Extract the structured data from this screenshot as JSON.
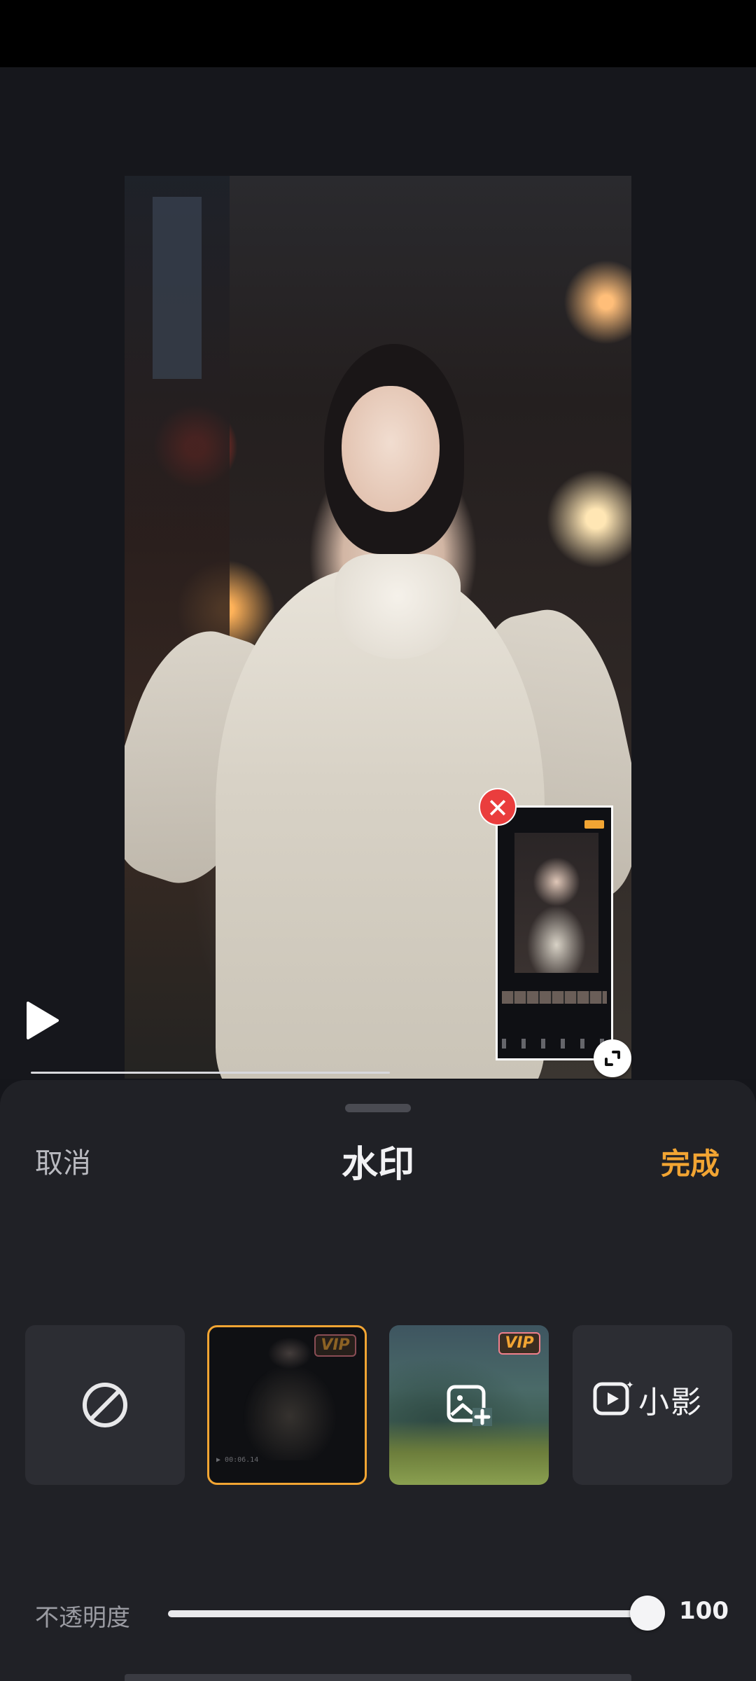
{
  "panel": {
    "title": "水印",
    "cancel_label": "取消",
    "done_label": "完成"
  },
  "watermark_options": [
    {
      "id": "none",
      "icon": "forbidden-icon",
      "vip": false
    },
    {
      "id": "default",
      "vip": true,
      "badge": "VIP",
      "time_text": "00:06.14",
      "selected": true
    },
    {
      "id": "custom-image",
      "icon": "image-add-icon",
      "vip": true,
      "badge": "VIP"
    },
    {
      "id": "xiaoying",
      "icon": "xiaoying-logo-icon",
      "label": "小影"
    }
  ],
  "opacity": {
    "label": "不透明度",
    "value": "100"
  },
  "colors": {
    "accent": "#f2a533",
    "panel": "#202126",
    "close_badge": "#ea3d3d"
  },
  "playback": {
    "progress_fraction": 0.48
  }
}
